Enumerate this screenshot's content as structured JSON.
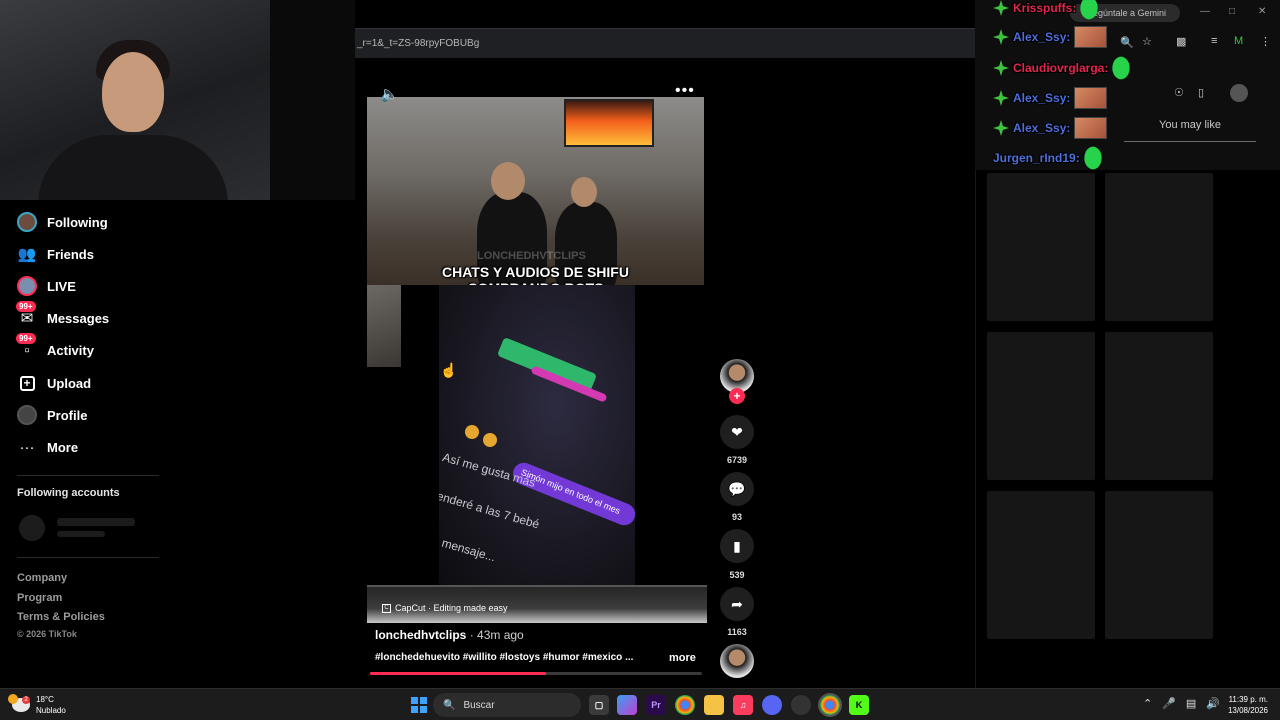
{
  "browser": {
    "url_fragment": "_r=1&_t=ZS-98rpyFOBUBg",
    "gemini_pill": "Pregúntale a Gemini"
  },
  "sidebar": {
    "items": [
      {
        "label": "Following",
        "icon": "following-avatar-icon"
      },
      {
        "label": "Friends",
        "icon": "friends-icon"
      },
      {
        "label": "LIVE",
        "icon": "live-icon"
      },
      {
        "label": "Messages",
        "icon": "messages-icon",
        "badge": "99+"
      },
      {
        "label": "Activity",
        "icon": "activity-icon",
        "badge": "99+"
      },
      {
        "label": "Upload",
        "icon": "upload-icon"
      },
      {
        "label": "Profile",
        "icon": "profile-icon"
      },
      {
        "label": "More",
        "icon": "more-icon"
      }
    ],
    "following_accounts_title": "Following accounts",
    "footer_links": [
      "Company",
      "Program",
      "Terms & Policies"
    ],
    "copyright": "© 2026 TikTok"
  },
  "video": {
    "caption_line1": "CHATS Y AUDIOS DE SHIFU",
    "caption_line2": "COMPRANDO BOTS",
    "watermark": "LONCHEDHVTCLIPS",
    "chat_bubble": "Simón mijo en todo el mes",
    "chat_text1": "Así me gusta más",
    "chat_text2": "enderé a las 7 bebé",
    "chat_text3": "mensaje...",
    "capcut_label": "CapCut · Editing made easy",
    "author": "lonchedhvtclips",
    "posted": "· 43m ago",
    "hashtags": "#lonchedehuevito #willito #lostoys #humor #mexico ...",
    "more_label": "more",
    "progress": 0.53
  },
  "actions": {
    "likes": "6739",
    "comments": "93",
    "saves": "539",
    "shares": "1163",
    "follow_plus": "+"
  },
  "chat": [
    {
      "user": "Krisspuffs:",
      "color": "#e2264d",
      "emote": "rock"
    },
    {
      "user": "Alex_Ssy:",
      "color": "#4c6fdc",
      "emote": "image"
    },
    {
      "user": "Claudiovrglarga:",
      "color": "#e2264d",
      "emote": "rock"
    },
    {
      "user": "Alex_Ssy:",
      "color": "#4c6fdc",
      "emote": "image"
    },
    {
      "user": "Alex_Ssy:",
      "color": "#4c6fdc",
      "emote": "image"
    },
    {
      "user": "Jurgen_rInd19:",
      "color": "#4c6fdc",
      "emote": "rock"
    }
  ],
  "right_panel": {
    "you_may_like": "You may like"
  },
  "taskbar": {
    "temperature": "18°C",
    "weather": "Nublado",
    "weather_badge": "2",
    "search_placeholder": "Buscar",
    "time": "11:39 p. m.",
    "date": "13/08/2026"
  },
  "colors": {
    "accent": "#fe2c55",
    "progress": "#fe2c55"
  }
}
